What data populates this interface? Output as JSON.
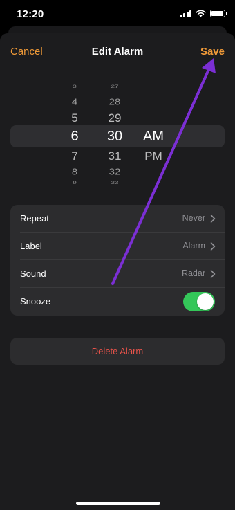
{
  "status_bar": {
    "time": "12:20",
    "battery_level": 0.95
  },
  "nav": {
    "cancel": "Cancel",
    "title": "Edit Alarm",
    "save": "Save"
  },
  "picker": {
    "hours": [
      "3",
      "4",
      "5",
      "6",
      "7",
      "8",
      "9"
    ],
    "minutes": [
      "27",
      "28",
      "29",
      "30",
      "31",
      "32",
      "33"
    ],
    "periods": [
      "AM",
      "PM"
    ],
    "selected": {
      "hour": "6",
      "minute": "30",
      "period": "AM"
    }
  },
  "settings": {
    "repeat": {
      "label": "Repeat",
      "value": "Never"
    },
    "label": {
      "label": "Label",
      "value": "Alarm"
    },
    "sound": {
      "label": "Sound",
      "value": "Radar"
    },
    "snooze": {
      "label": "Snooze",
      "on": true
    }
  },
  "delete_label": "Delete Alarm",
  "colors": {
    "accent": "#f09a38",
    "toggle_on": "#34c759",
    "destructive": "#e8534a",
    "annotation_arrow": "#7b2fd4"
  }
}
